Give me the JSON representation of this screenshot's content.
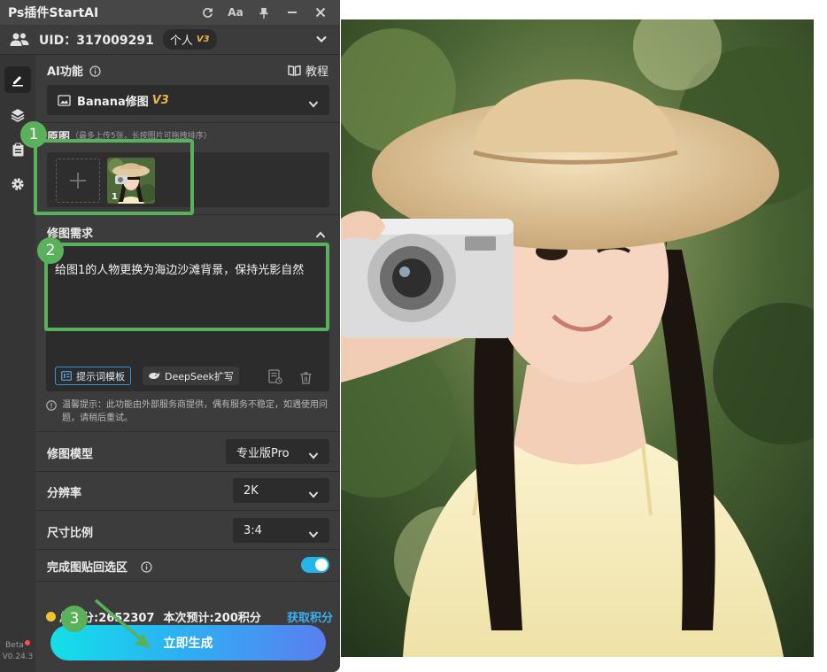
{
  "window": {
    "title": "Ps插件StartAI",
    "icons": [
      "refresh-icon",
      "font-size-icon",
      "pin-icon",
      "minimize-icon",
      "close-icon"
    ],
    "font_icon_text": "Aa"
  },
  "user": {
    "uid_text": "UID：317009291",
    "plan": "个人",
    "plan_level": "V3"
  },
  "sidebar": {
    "items": [
      "edit-icon",
      "layers-icon",
      "clipboard-icon",
      "gear-icon"
    ],
    "beta_label": "Beta",
    "version": "V0.24.3"
  },
  "ai_function": {
    "label": "AI功能",
    "tutorial_label": "教程",
    "selected_model": "Banana修图",
    "model_badge": "V3"
  },
  "source_images": {
    "label": "原图",
    "hint": "（最多上传5张，长按图片可拖拽排序）",
    "thumb_index": "1"
  },
  "edit_request": {
    "label": "修图需求",
    "text": "给图1的人物更换为海边沙滩背景，保持光影自然",
    "template_button": "提示词模板",
    "deepseek_button": "DeepSeek扩写"
  },
  "notice": "温馨提示：此功能由外部服务商提供，偶有服务不稳定，如遇使用问题，请稍后重试。",
  "settings": {
    "model_label": "修图模型",
    "model_value": "专业版Pro",
    "resolution_label": "分辨率",
    "resolution_value": "2K",
    "ratio_label": "尺寸比例",
    "ratio_value": "3:4",
    "paste_back_label": "完成图贴回选区",
    "paste_back_on": true
  },
  "footer": {
    "credits_text": "总积分:2652307",
    "estimate_text": "本次预计:200积分",
    "get_credits": "获取积分",
    "generate_button": "立即生成"
  },
  "annotations": {
    "step1": "1",
    "step2": "2",
    "step3": "3",
    "color": "#5bb05b"
  },
  "colors": {
    "panel_bg": "#3c3c3c",
    "accent": "#22b7e6",
    "badge_gold": "#e8b34a"
  }
}
